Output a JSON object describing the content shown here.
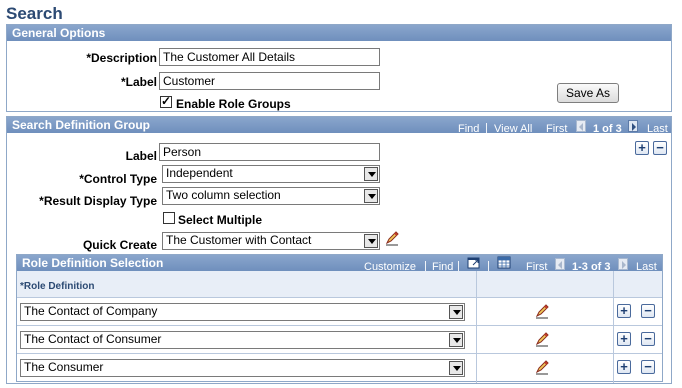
{
  "page": {
    "title": "Search"
  },
  "general_options": {
    "header": "General Options",
    "description_label": "*Description",
    "description_value": "The Customer All Details",
    "label_label": "*Label",
    "label_value": "Customer",
    "enable_role_groups_label": "Enable Role Groups",
    "enable_role_groups_checked": true,
    "save_as_label": "Save As"
  },
  "search_definition_group": {
    "header": "Search Definition Group",
    "nav": {
      "find": "Find",
      "sep": "|",
      "view_all": "View All",
      "first": "First",
      "range": "1 of 3",
      "last": "Last"
    },
    "label_label": "Label",
    "label_value": "Person",
    "control_type_label": "*Control Type",
    "control_type_value": "Independent",
    "result_display_type_label": "*Result Display Type",
    "result_display_type_value": "Two column selection",
    "select_multiple_label": "Select Multiple",
    "select_multiple_checked": false,
    "quick_create_label": "Quick Create",
    "quick_create_value": "The Customer with Contact"
  },
  "role_definition_selection": {
    "header": "Role Definition Selection",
    "nav": {
      "customize": "Customize",
      "sep": "|",
      "find": "Find",
      "first": "First",
      "range": "1-3 of 3",
      "last": "Last"
    },
    "column_header": "*Role Definition",
    "rows": [
      {
        "value": "The Contact of Company"
      },
      {
        "value": "The Contact of Consumer"
      },
      {
        "value": "The Consumer"
      }
    ]
  },
  "icons": {
    "add": "+",
    "remove": "−"
  },
  "colors": {
    "title": "#2c4a73",
    "panel_header": "#7594c0",
    "panel_border": "#8fa8c8"
  }
}
